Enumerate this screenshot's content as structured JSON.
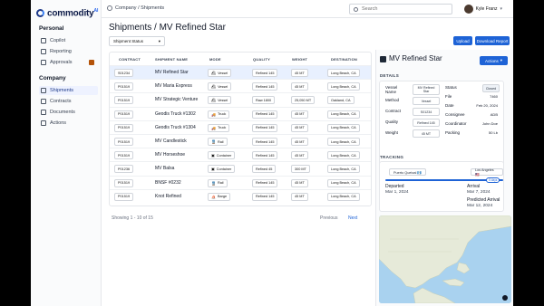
{
  "app": {
    "logo": "commodity",
    "logo_sup": "AI"
  },
  "sidebar": {
    "sections": [
      {
        "title": "Personal",
        "items": [
          {
            "label": "Copilot",
            "icon": "sparkle-icon"
          },
          {
            "label": "Reporting",
            "icon": "chart-icon"
          },
          {
            "label": "Approvals",
            "icon": "check-icon"
          }
        ]
      },
      {
        "title": "Company",
        "items": [
          {
            "label": "Shipments",
            "icon": "ship-icon"
          },
          {
            "label": "Contracts",
            "icon": "contract-icon"
          },
          {
            "label": "Documents",
            "icon": "document-icon"
          },
          {
            "label": "Actions",
            "icon": "bolt-icon"
          }
        ]
      }
    ]
  },
  "topbar": {
    "breadcrumb": "Company / Shipments",
    "search_placeholder": "Search",
    "user_name": "Kyle Franz"
  },
  "page": {
    "title": "Shipments / MV Refined Star",
    "filter_label": "Shipment Status",
    "upload_label": "Upload",
    "download_label": "Download Report"
  },
  "table": {
    "headers": [
      "CONTRACT",
      "SHIPMENT NAME",
      "MODE",
      "QUALITY",
      "WEIGHT",
      "DESTINATION"
    ],
    "rows": [
      {
        "contract": "S01234",
        "name": "MV Refined Star",
        "mode": "Vessel",
        "quality": "Refined 145",
        "weight": "45 MT",
        "destination": "Long Beach, CA"
      },
      {
        "contract": "P01519",
        "name": "MV Maria Express",
        "mode": "Vessel",
        "quality": "Refined 145",
        "weight": "45 MT",
        "destination": "Long Beach, CA"
      },
      {
        "contract": "P01519",
        "name": "MV Strategic Venture",
        "mode": "Vessel",
        "quality": "Raw 1800",
        "weight": "25,050 MT",
        "destination": "Oakland, CA"
      },
      {
        "contract": "P01519",
        "name": "Geodis Truck #1302",
        "mode": "Truck",
        "quality": "Refined 145",
        "weight": "45 MT",
        "destination": "Long Beach, CA"
      },
      {
        "contract": "P01519",
        "name": "Geodis Truck #1304",
        "mode": "Truck",
        "quality": "Refined 145",
        "weight": "45 MT",
        "destination": "Long Beach, CA"
      },
      {
        "contract": "P01519",
        "name": "MV Candlestick",
        "mode": "Rail",
        "quality": "Refined 145",
        "weight": "45 MT",
        "destination": "Long Beach, CA"
      },
      {
        "contract": "P01519",
        "name": "MV Horseshoe",
        "mode": "Container",
        "quality": "Refined 145",
        "weight": "45 MT",
        "destination": "Long Beach, CA"
      },
      {
        "contract": "P01236",
        "name": "MV Balsa",
        "mode": "Container",
        "quality": "Refined 45",
        "weight": "300 MT",
        "destination": "Long Beach, CA"
      },
      {
        "contract": "P01519",
        "name": "BNSF #0232",
        "mode": "Rail",
        "quality": "Refined 145",
        "weight": "45 MT",
        "destination": "Long Beach, CA"
      },
      {
        "contract": "P01519",
        "name": "Knot Refined",
        "mode": "Barge",
        "quality": "Refined 145",
        "weight": "45 MT",
        "destination": "Long Beach, CA"
      }
    ],
    "pager_info": "Showing 1 - 10 of 15",
    "prev_label": "Previous",
    "next_label": "Next"
  },
  "detail": {
    "title": "MV Refined Star",
    "actions_label": "Actions",
    "details_label": "DETAILS",
    "left": [
      {
        "k": "Vessel Name",
        "v": "MV Refined Star"
      },
      {
        "k": "Method",
        "v": "Vessel"
      },
      {
        "k": "Contract",
        "v": "S01234"
      },
      {
        "k": "Quality",
        "v": "Refined 145"
      },
      {
        "k": "Weight",
        "v": "45 MT"
      }
    ],
    "right": [
      {
        "k": "Status",
        "v": "Closed"
      },
      {
        "k": "File",
        "v": "7460"
      },
      {
        "k": "Date",
        "v": "Feb 20, 2024"
      },
      {
        "k": "Consignee",
        "v": "ADB"
      },
      {
        "k": "Coordinator",
        "v": "John Doe"
      },
      {
        "k": "Packing",
        "v": "50 Lb"
      }
    ],
    "tracking_label": "TRACKING",
    "from_port": "Puerto Quetzal 🇬🇹",
    "to_port": "Los Angeles 🇺🇸",
    "days_badge": "0 days",
    "departed_label": "Departed",
    "departed_date": "Mar 1, 2024",
    "arrival_label": "Arrival",
    "arrival_date": "Mar 7, 2024",
    "predicted_label": "Predicted Arrival",
    "predicted_date": "Mar 12, 2024"
  },
  "colors": {
    "primary": "#1e63d6",
    "selected_row": "#e8f0fe",
    "ocean": "#a9d2ef",
    "land": "#e6ead9"
  }
}
